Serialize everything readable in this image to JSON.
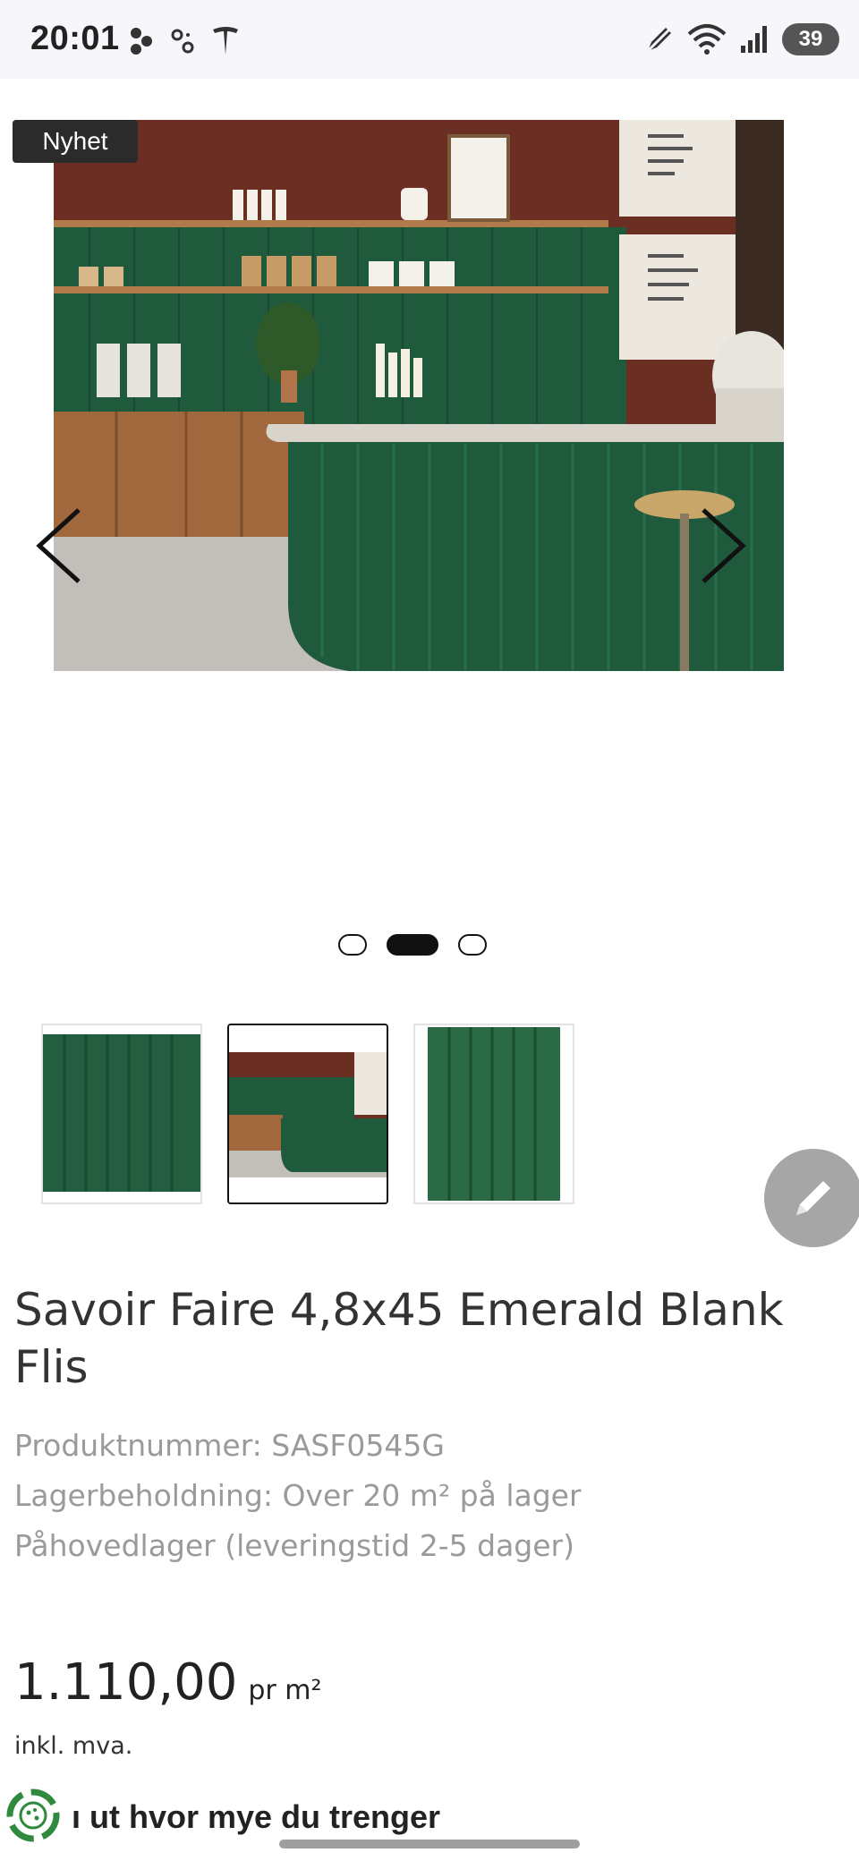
{
  "status_bar": {
    "time": "20:01",
    "battery": "39",
    "icons_left": [
      "fan-icon",
      "dots-icon",
      "tesla-icon"
    ],
    "icons_right": [
      "pen-icon",
      "wifi-icon",
      "signal-icon",
      "battery-icon"
    ]
  },
  "gallery": {
    "badge": "Nyhet",
    "current_index": 2,
    "total": 3,
    "icons": [
      "chevron-left-icon",
      "chevron-right-icon"
    ]
  },
  "product": {
    "title": "Savoir Faire 4,8x45 Emerald Blank Flis",
    "product_number": "Produktnummer: SASF0545G",
    "stock": "Lagerbeholdning: Over 20 m² på lager",
    "warehouse": "Påhovedlager (leveringstid 2-5 dager)",
    "price": "1.110,00",
    "price_unit": "pr m²",
    "vat_note": "inkl. mva."
  },
  "calculator": {
    "label": "ı ut hvor mye du trenger"
  },
  "colors": {
    "tile_green": "#1f5a3c",
    "wood": "#a0683c",
    "wall_brown": "#6b2e22",
    "fab_grey": "#a6a6a6"
  }
}
